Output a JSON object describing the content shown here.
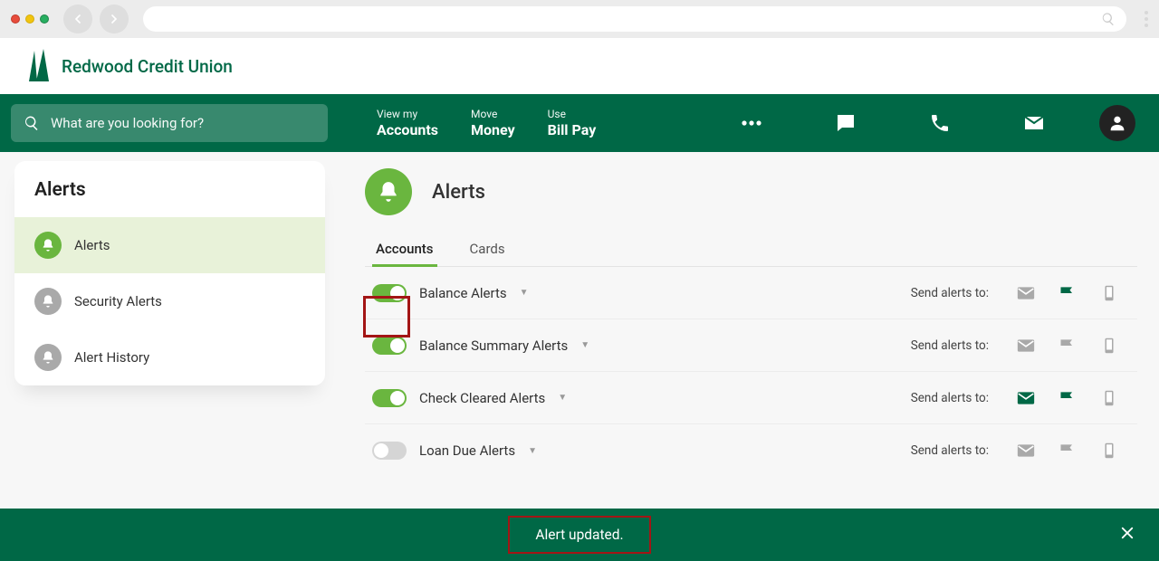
{
  "brand": {
    "name": "Redwood Credit Union"
  },
  "search": {
    "placeholder": "What are you looking for?"
  },
  "nav": {
    "items": [
      {
        "small": "View my",
        "big": "Accounts"
      },
      {
        "small": "Move",
        "big": "Money"
      },
      {
        "small": "Use",
        "big": "Bill Pay"
      }
    ]
  },
  "sidebar": {
    "title": "Alerts",
    "items": [
      {
        "id": "alerts",
        "label": "Alerts",
        "active": true
      },
      {
        "id": "security",
        "label": "Security Alerts",
        "active": false
      },
      {
        "id": "history",
        "label": "Alert History",
        "active": false
      }
    ]
  },
  "page": {
    "title": "Alerts",
    "tabs": [
      {
        "label": "Accounts",
        "active": true
      },
      {
        "label": "Cards",
        "active": false
      }
    ],
    "send_to_label": "Send alerts to:",
    "alerts": [
      {
        "label": "Balance Alerts",
        "on": true,
        "channels": {
          "email": false,
          "text": true,
          "phone": false
        }
      },
      {
        "label": "Balance Summary Alerts",
        "on": true,
        "channels": {
          "email": false,
          "text": false,
          "phone": false
        }
      },
      {
        "label": "Check Cleared Alerts",
        "on": true,
        "channels": {
          "email": true,
          "text": true,
          "phone": false
        }
      },
      {
        "label": "Loan Due Alerts",
        "on": false,
        "channels": {
          "email": false,
          "text": false,
          "phone": false
        }
      }
    ]
  },
  "toast": {
    "message": "Alert updated."
  }
}
